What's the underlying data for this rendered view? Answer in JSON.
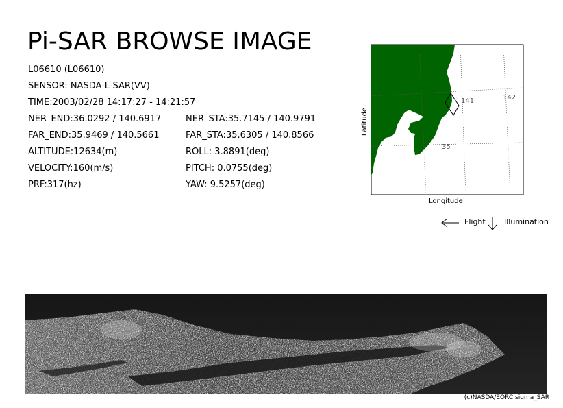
{
  "title": "Pi-SAR BROWSE IMAGE",
  "id_line": "L06610 (L06610)",
  "sensor": "SENSOR: NASDA-L-SAR(VV)",
  "time": "TIME:2003/02/28  14:17:27 - 14:21:57",
  "params_left": [
    "NER_END:36.0292 / 140.6917",
    "FAR_END:35.9469 / 140.5661",
    "ALTITUDE:12634(m)",
    "VELOCITY:160(m/s)",
    "PRF:317(hz)"
  ],
  "params_right": [
    "NER_STA:35.7145 / 140.9791",
    "FAR_STA:35.6305 / 140.8566",
    "ROLL: 3.8891(deg)",
    "PITCH:  0.0755(deg)",
    "YAW:   9.5257(deg)"
  ],
  "map": {
    "xlabel": "Longitude",
    "ylabel": "Latitude",
    "grid_labels": [
      "141",
      "142",
      "35"
    ],
    "land_color": "#006400"
  },
  "legend": {
    "flight_label": "Flight",
    "illumination_label": "Illumination",
    "flight_icon": "arrow-left-icon",
    "illumination_icon": "arrow-down-icon"
  },
  "credit": "(c)NASDA/EORC sigma_SAR"
}
